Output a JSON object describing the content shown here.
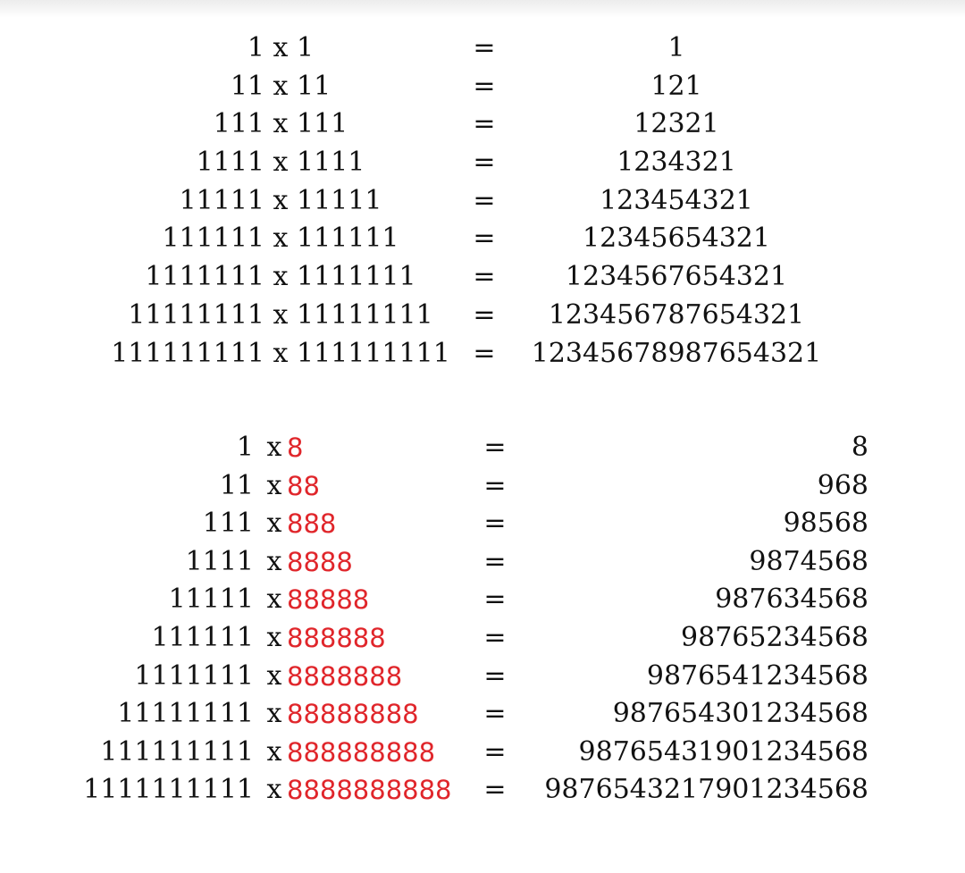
{
  "section_ones": {
    "rows": [
      {
        "expression": "1 x 1",
        "equals": "=",
        "result": "1"
      },
      {
        "expression": "11 x 11",
        "equals": "=",
        "result": "121"
      },
      {
        "expression": "111 x 111",
        "equals": "=",
        "result": "12321"
      },
      {
        "expression": "1111 x 1111",
        "equals": "=",
        "result": "1234321"
      },
      {
        "expression": "11111 x 11111",
        "equals": "=",
        "result": "123454321"
      },
      {
        "expression": "111111 x 111111",
        "equals": "=",
        "result": "12345654321"
      },
      {
        "expression": "1111111 x 1111111",
        "equals": "=",
        "result": "1234567654321"
      },
      {
        "expression": "11111111 x 11111111",
        "equals": "=",
        "result": "123456787654321"
      },
      {
        "expression": "111111111 x 111111111",
        "equals": "=",
        "result": "12345678987654321"
      }
    ]
  },
  "section_eights": {
    "highlight_color": "#e0262b",
    "rows": [
      {
        "left": "1",
        "times": "x",
        "multiplier": "8",
        "equals": "=",
        "result": "8"
      },
      {
        "left": "11",
        "times": "x",
        "multiplier": "88",
        "equals": "=",
        "result": "968"
      },
      {
        "left": "111",
        "times": "x",
        "multiplier": "888",
        "equals": "=",
        "result": "98568"
      },
      {
        "left": "1111",
        "times": "x",
        "multiplier": "8888",
        "equals": "=",
        "result": "9874568"
      },
      {
        "left": "11111",
        "times": "x",
        "multiplier": "88888",
        "equals": "=",
        "result": "987634568"
      },
      {
        "left": "111111",
        "times": "x",
        "multiplier": "888888",
        "equals": "=",
        "result": "98765234568"
      },
      {
        "left": "1111111",
        "times": "x",
        "multiplier": "8888888",
        "equals": "=",
        "result": "9876541234568"
      },
      {
        "left": "11111111",
        "times": "x",
        "multiplier": "88888888",
        "equals": "=",
        "result": "987654301234568"
      },
      {
        "left": "111111111",
        "times": "x",
        "multiplier": "888888888",
        "equals": "=",
        "result": "98765431901234568"
      },
      {
        "left": "1111111111",
        "times": "x",
        "multiplier": "8888888888",
        "equals": "=",
        "result": "9876543217901234568"
      }
    ]
  }
}
